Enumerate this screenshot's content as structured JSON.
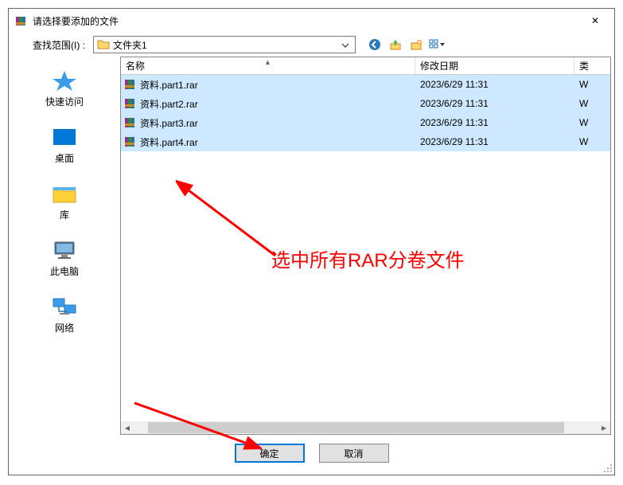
{
  "window": {
    "title": "请选择要添加的文件",
    "close_glyph": "✕"
  },
  "toolbar": {
    "label": "查找范围(I) :",
    "path": "文件夹1",
    "icons": {
      "back": "←",
      "up": "↑",
      "newfolder": "📁*",
      "view": "▦▾"
    }
  },
  "sidebar": {
    "items": [
      {
        "id": "quick",
        "label": "快速访问"
      },
      {
        "id": "desktop",
        "label": "桌面"
      },
      {
        "id": "libraries",
        "label": "库"
      },
      {
        "id": "thispc",
        "label": "此电脑"
      },
      {
        "id": "network",
        "label": "网络"
      }
    ]
  },
  "file_list": {
    "columns": {
      "name": "名称",
      "date": "修改日期",
      "type": "类"
    },
    "rows": [
      {
        "name": "资料.part1.rar",
        "date": "2023/6/29 11:31",
        "type": "W"
      },
      {
        "name": "资料.part2.rar",
        "date": "2023/6/29 11:31",
        "type": "W"
      },
      {
        "name": "资料.part3.rar",
        "date": "2023/6/29 11:31",
        "type": "W"
      },
      {
        "name": "资料.part4.rar",
        "date": "2023/6/29 11:31",
        "type": "W"
      }
    ]
  },
  "buttons": {
    "ok": "确定",
    "cancel": "取消"
  },
  "annotation": {
    "text": "选中所有RAR分卷文件"
  }
}
